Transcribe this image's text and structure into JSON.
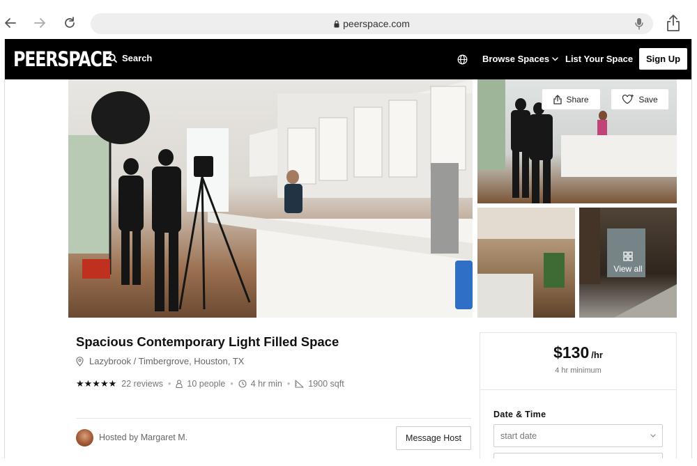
{
  "browser": {
    "url": "peerspace.com"
  },
  "nav": {
    "logo": "PEERSPACE",
    "search_label": "Search",
    "browse_label": "Browse Spaces",
    "list_label": "List Your Space",
    "signup_label": "Sign Up"
  },
  "gallery": {
    "share_label": "Share",
    "save_label": "Save",
    "view_all_label": "View all"
  },
  "listing": {
    "title": "Spacious Contemporary Light Filled Space",
    "location": "Lazybrook / Timbergrove, Houston, TX",
    "rating_stars": "★★★★★",
    "rating": 5,
    "reviews": "22 reviews",
    "capacity": "10 people",
    "min_hours": "4 hr min",
    "size": "1900 sqft",
    "hosted_by": "Hosted by Margaret M.",
    "message_label": "Message Host"
  },
  "booking": {
    "price": "$130",
    "unit": "/hr",
    "minimum": "4 hr minimum",
    "date_time_label": "Date & Time",
    "start_date_placeholder": "start date"
  }
}
